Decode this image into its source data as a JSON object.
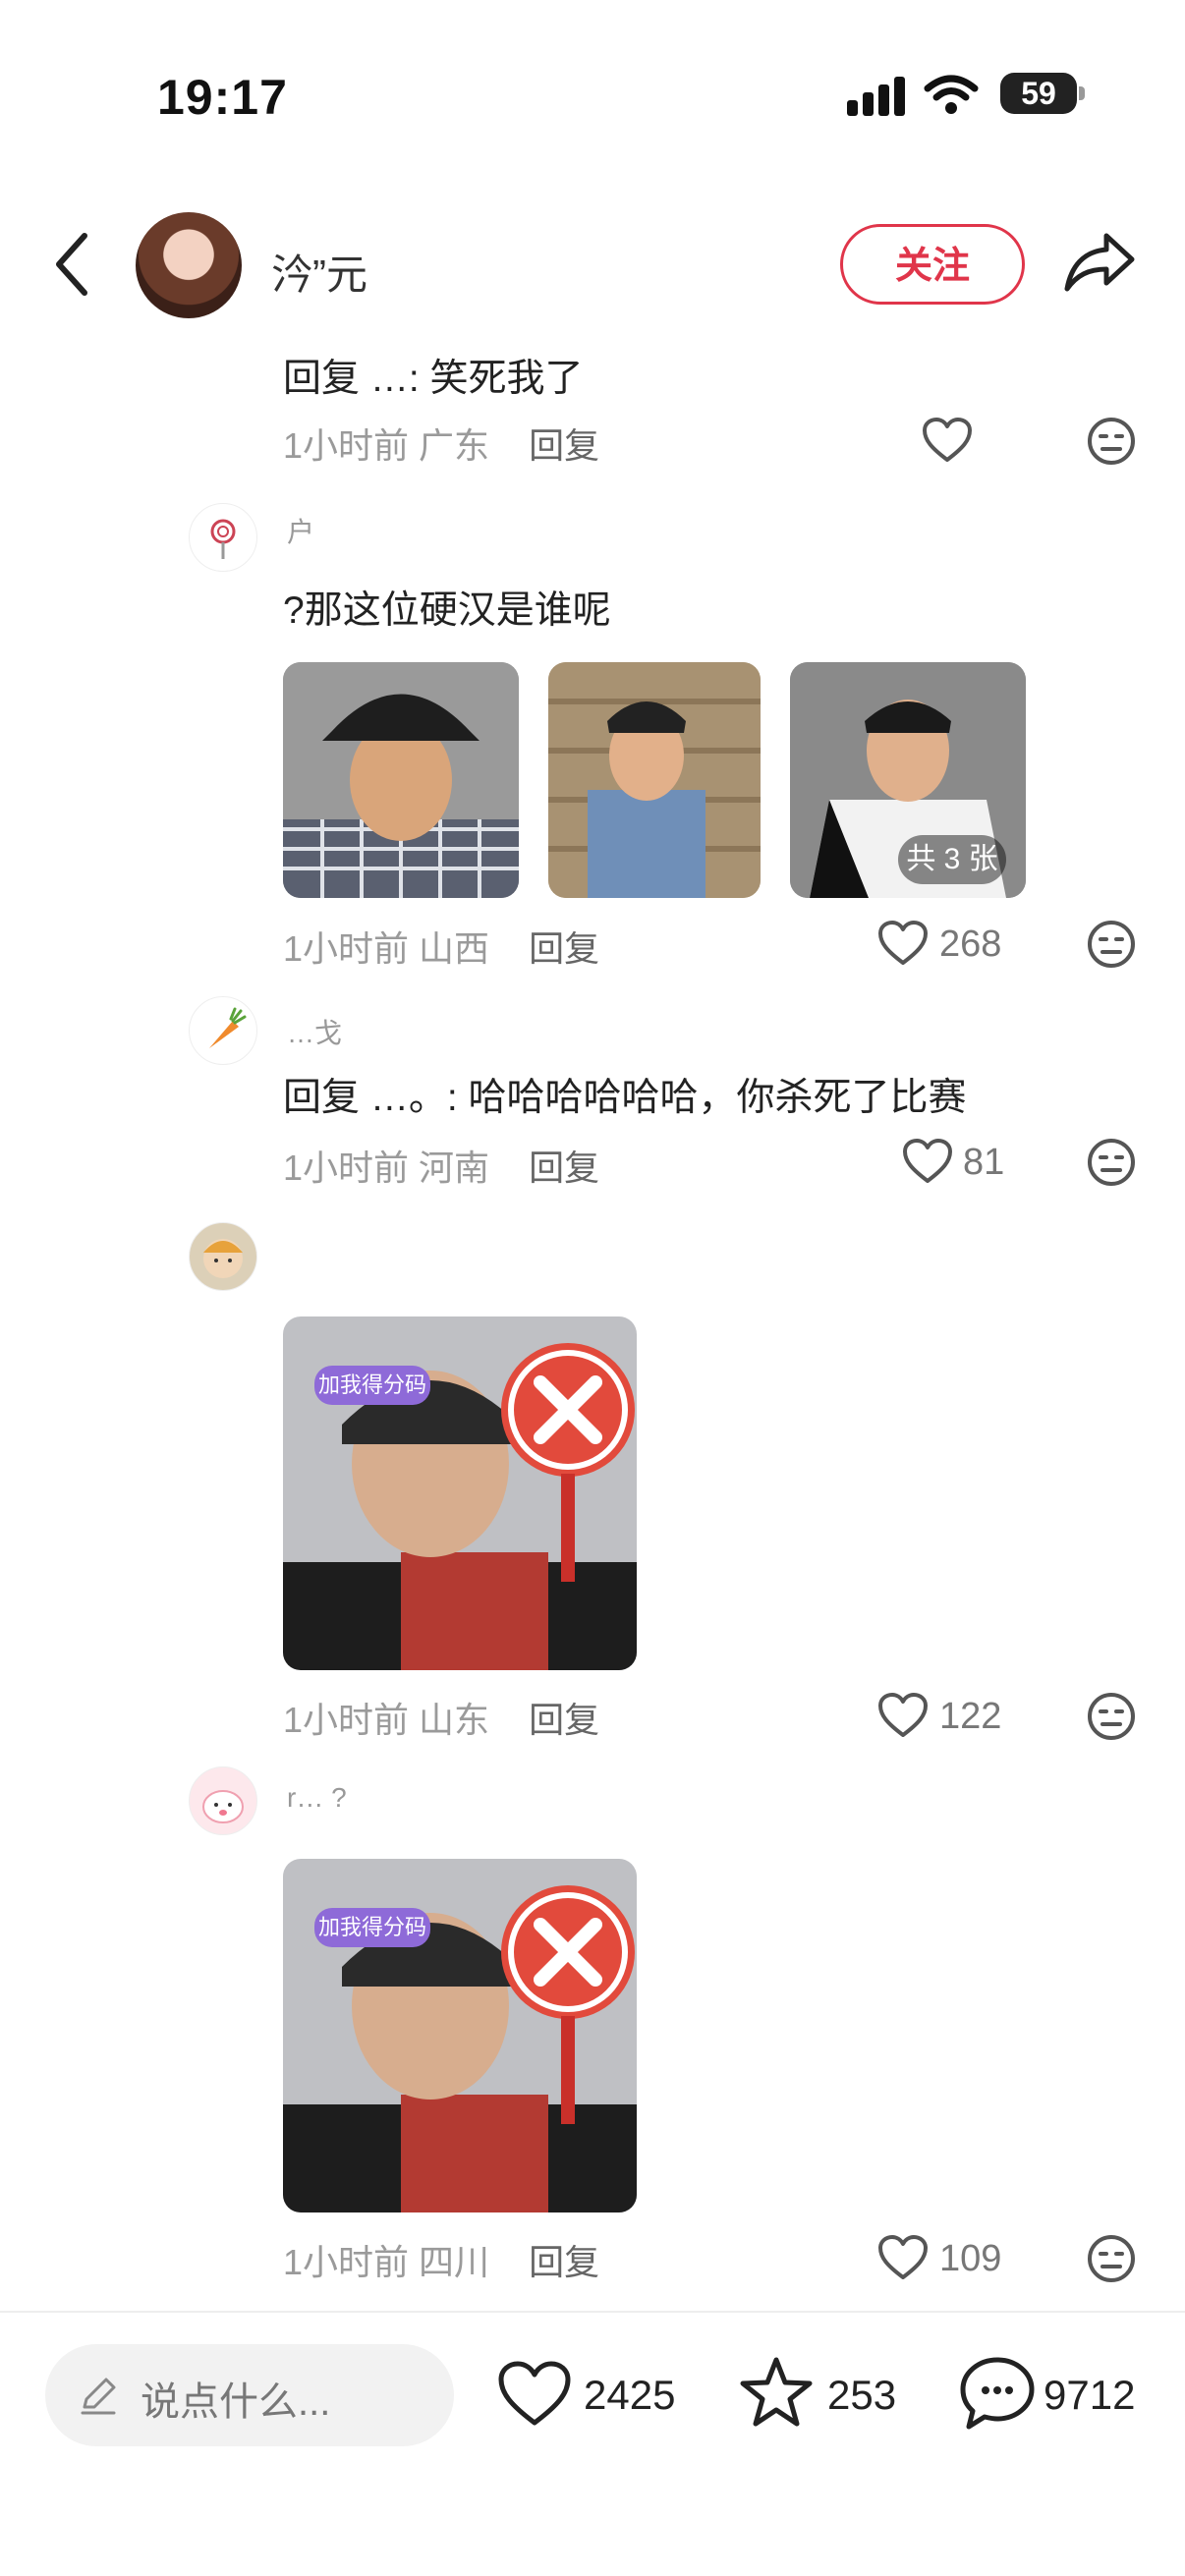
{
  "status_bar": {
    "time": "19:17",
    "battery": "59"
  },
  "header": {
    "author": "汵”元",
    "follow_label": "关注"
  },
  "comments": [
    {
      "text": "回复 …: 笑死我了",
      "time": "1小时前",
      "location": "广东",
      "reply": "回复",
      "likes": ""
    },
    {
      "user": "户",
      "text": "?那这位硬汉是谁呢",
      "time": "1小时前",
      "location": "山西",
      "reply": "回复",
      "likes": "268",
      "image_badge": "共 3 张"
    },
    {
      "user": "…戈",
      "text": "回复 …。: 哈哈哈哈哈哈，你杀死了比赛",
      "time": "1小时前",
      "location": "河南",
      "reply": "回复",
      "likes": "81"
    },
    {
      "user": "",
      "time": "1小时前",
      "location": "山东",
      "reply": "回复",
      "likes": "122"
    },
    {
      "user": "r… ?",
      "time": "1小时前",
      "location": "四川",
      "reply": "回复",
      "likes": "109"
    }
  ],
  "meme_banner_text": "加我得分码",
  "bottom_bar": {
    "placeholder": "说点什么...",
    "likes": "2425",
    "stars": "253",
    "comments": "9712"
  },
  "colors": {
    "accent": "#e0354a",
    "meta_gray": "#9a9a9a"
  },
  "icons": [
    "back-icon",
    "share-icon",
    "heart-icon",
    "dislike-face-icon",
    "pencil-icon",
    "star-icon",
    "comment-icon",
    "signal-icon",
    "wifi-icon",
    "battery-icon"
  ]
}
